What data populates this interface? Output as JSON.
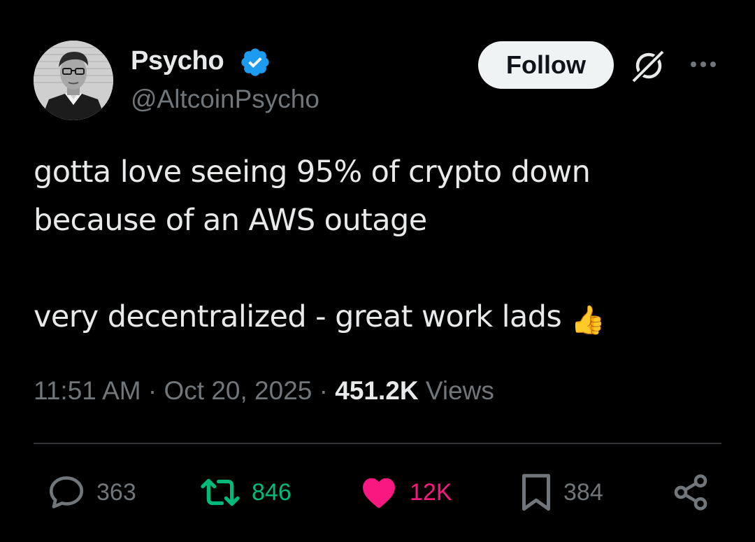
{
  "author": {
    "name": "Psycho",
    "handle": "@AltcoinPsycho",
    "verified": true
  },
  "header": {
    "follow_label": "Follow"
  },
  "tweet": {
    "line1": "gotta love seeing 95% of crypto down",
    "line2": "because of an AWS outage",
    "line3": "very decentralized - great work lads",
    "emoji": "👍"
  },
  "meta": {
    "time": "11:51 AM",
    "date": "Oct 20, 2025",
    "views_count": "451.2K",
    "views_label": "Views",
    "separator": "·"
  },
  "actions": {
    "replies": "363",
    "reposts": "846",
    "likes": "12K",
    "bookmarks": "384"
  },
  "colors": {
    "background": "#000000",
    "text": "#e7e9ea",
    "muted": "#71767b",
    "verified": "#1d9bf0",
    "repost": "#00ba7c",
    "like": "#f91880"
  },
  "icons": {
    "reply": "reply-icon",
    "repost": "repost-icon",
    "like": "heart-icon",
    "bookmark": "bookmark-icon",
    "share": "share-icon",
    "grok": "grok-icon",
    "more": "more-icon",
    "verified": "verified-badge-icon"
  }
}
